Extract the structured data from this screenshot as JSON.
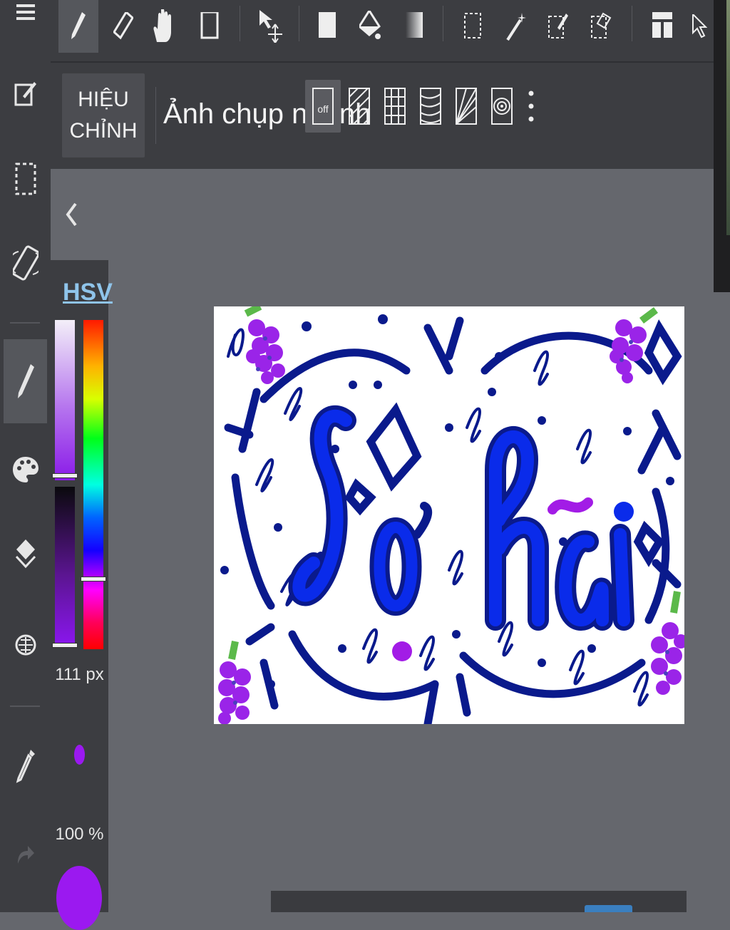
{
  "toolbar": {
    "tools": [
      "menu",
      "pen",
      "eraser",
      "hand",
      "rect",
      "move",
      "fill",
      "bucket",
      "gradient",
      "select-rect",
      "magic-wand",
      "select-pen",
      "select-eraser",
      "layer-panel",
      "cursor"
    ]
  },
  "options": {
    "adjust_label_line1": "HIỆU",
    "adjust_label_line2": "CHỈNH",
    "snap_label": "Ảnh chụp nhanh",
    "snap_off_label": "off"
  },
  "color_panel": {
    "mode_label": "HSV",
    "brush_size": "111 px",
    "opacity": "100 %",
    "current_color": "#9b19f0"
  },
  "canvas": {
    "text_main": "Sở hãi",
    "accent_colors": {
      "navy": "#0a1a8c",
      "blue": "#0a2bea",
      "purple": "#a21ce6",
      "green": "#5bb94a"
    }
  }
}
